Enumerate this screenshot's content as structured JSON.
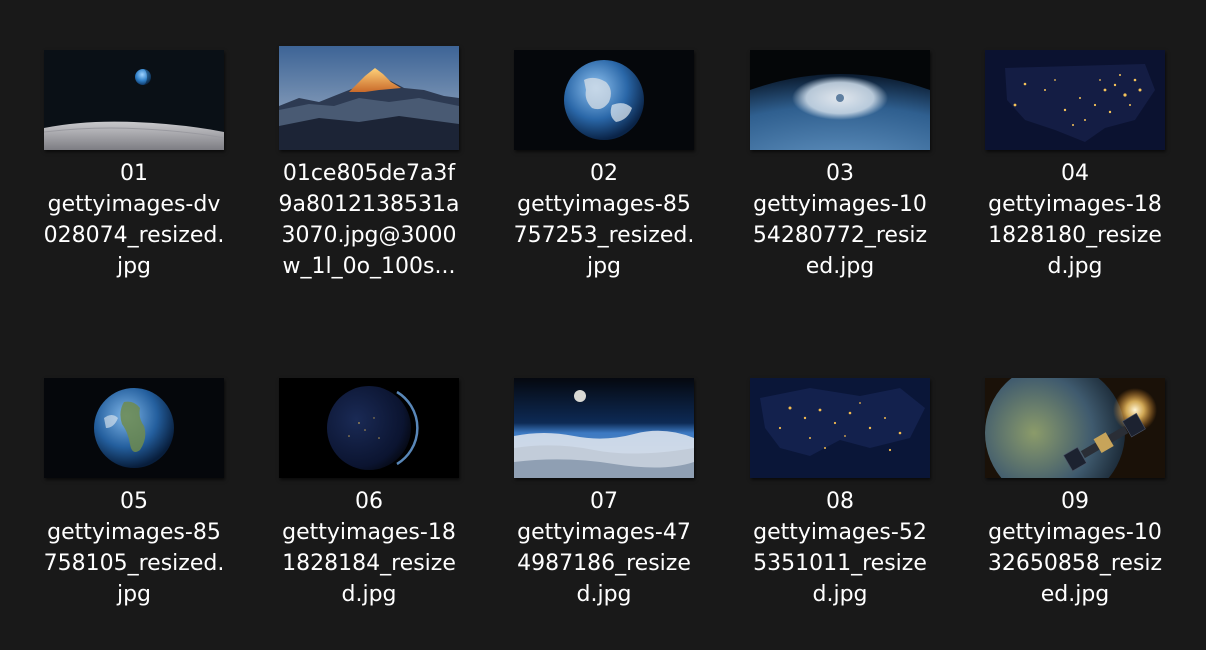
{
  "files": [
    {
      "lines": [
        "01",
        "gettyimages-dv",
        "028074_resized.",
        "jpg"
      ],
      "thumbnail": "earthrise-over-moon"
    },
    {
      "lines": [
        "01ce805de7a3f",
        "9a8012138531a",
        "3070.jpg@3000",
        "w_1l_0o_100s..."
      ],
      "thumbnail": "sunlit-mountain-peak"
    },
    {
      "lines": [
        "02",
        "gettyimages-85",
        "757253_resized.",
        "jpg"
      ],
      "thumbnail": "earth-globe"
    },
    {
      "lines": [
        "03",
        "gettyimages-10",
        "54280772_resiz",
        "ed.jpg"
      ],
      "thumbnail": "hurricane-from-orbit"
    },
    {
      "lines": [
        "04",
        "gettyimages-18",
        "1828180_resize",
        "d.jpg"
      ],
      "thumbnail": "usa-city-lights-at-night"
    },
    {
      "lines": [
        "05",
        "gettyimages-85",
        "758105_resized.",
        "jpg"
      ],
      "thumbnail": "earth-globe-americas"
    },
    {
      "lines": [
        "06",
        "gettyimages-18",
        "1828184_resize",
        "d.jpg"
      ],
      "thumbnail": "earth-night-side"
    },
    {
      "lines": [
        "07",
        "gettyimages-47",
        "4987186_resize",
        "d.jpg"
      ],
      "thumbnail": "moon-over-clouds"
    },
    {
      "lines": [
        "08",
        "gettyimages-52",
        "5351011_resize",
        "d.jpg"
      ],
      "thumbnail": "europe-city-lights-at-night"
    },
    {
      "lines": [
        "09",
        "gettyimages-10",
        "32650858_resiz",
        "ed.jpg"
      ],
      "thumbnail": "satellite-over-earth"
    }
  ]
}
